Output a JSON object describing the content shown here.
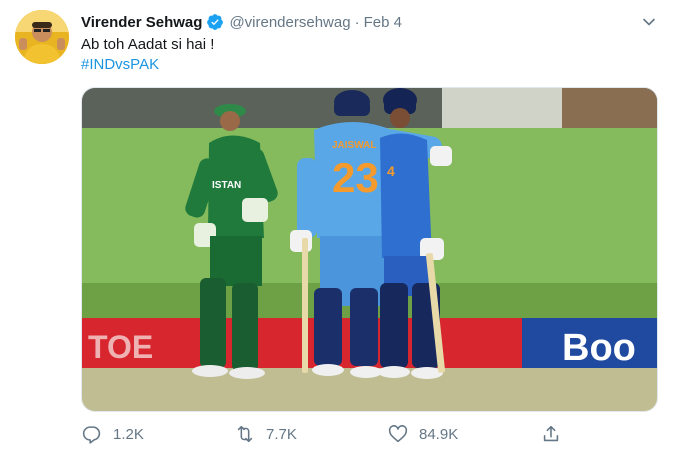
{
  "tweet": {
    "author": {
      "display_name": "Virender Sehwag",
      "handle": "@virendersehwag",
      "verified": true
    },
    "date": "Feb 4",
    "separator": "·",
    "text": "Ab toh Aadat si hai !",
    "hashtag": "#INDvsPAK",
    "media": {
      "jersey_name": "JAISWAL",
      "jersey_number": "23",
      "jersey_number_2": "4",
      "pak_chest_text": "ISTAN",
      "board_left": "TOE",
      "board_right": "Boo"
    },
    "actions": {
      "replies": "1.2K",
      "retweets": "7.7K",
      "likes": "84.9K"
    }
  },
  "colors": {
    "link": "#1b95e0",
    "secondary_text": "#657786",
    "verified": "#1da1f2"
  }
}
